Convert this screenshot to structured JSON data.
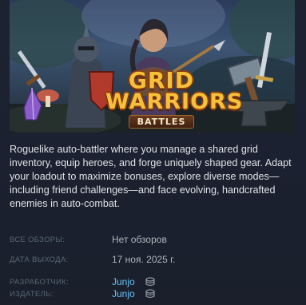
{
  "game": {
    "capsule_title_line1": "GRID",
    "capsule_title_line2": "WARRIORS",
    "capsule_subtitle": "BATTLES",
    "description": "Roguelike auto-battler where you manage a shared grid inventory, equip heroes, and forge uniquely shaped gear. Adapt your loadout to maximize bonuses, explore diverse modes—including friend challenges—and face evolving, handcrafted enemies in auto-combat."
  },
  "meta": {
    "reviews_label": "ВСЕ ОБЗОРЫ:",
    "reviews_value": "Нет обзоров",
    "release_label": "ДАТА ВЫХОДА:",
    "release_value": "17 ноя. 2025 г.",
    "developer_label": "РАЗРАБОТЧИК:",
    "developer_value": "Junjo",
    "publisher_label": "ИЗДАТЕЛЬ:",
    "publisher_value": "Junjo"
  },
  "colors": {
    "background": "#1b2130",
    "text": "#dfe3e6",
    "label": "#556772",
    "link": "#67c1f5",
    "logo_gold": "#f6c13a"
  },
  "icons": {
    "developer_icon": "stack-icon",
    "publisher_icon": "stack-icon"
  }
}
